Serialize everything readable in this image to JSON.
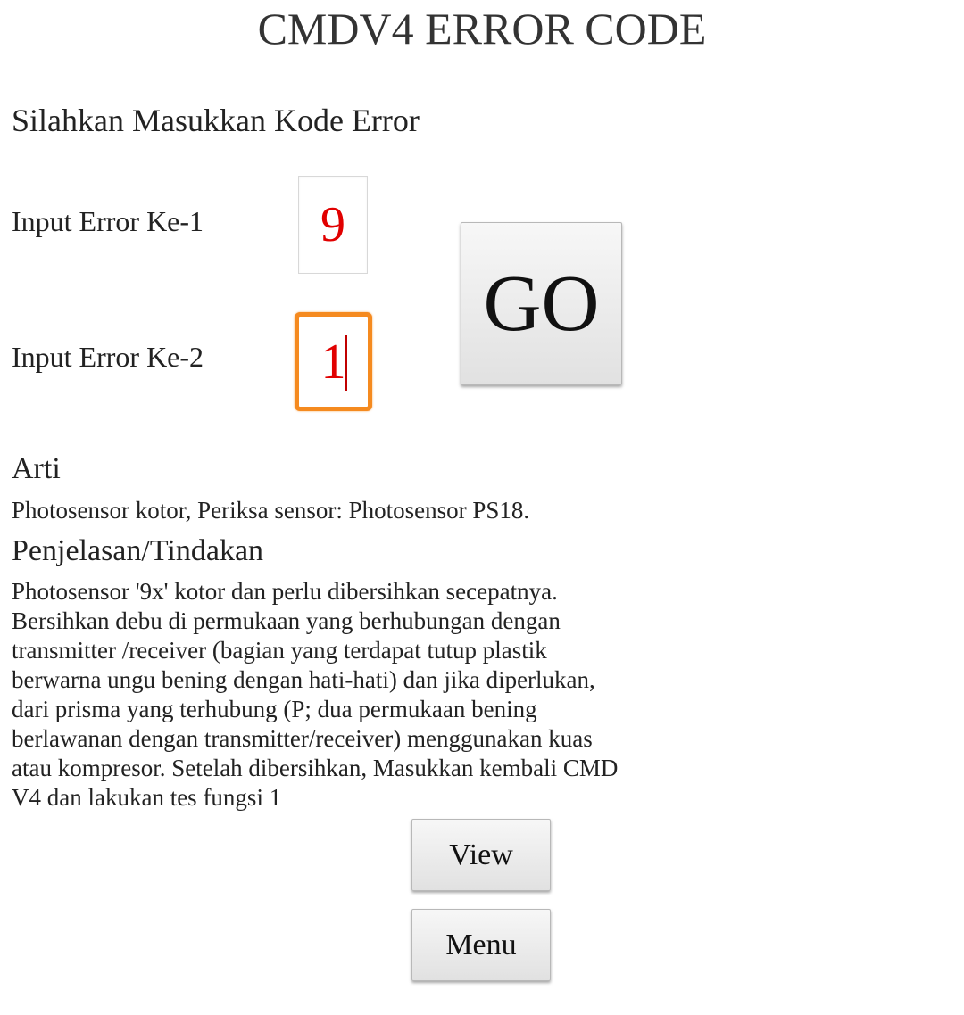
{
  "header": {
    "title": "CMDV4 ERROR CODE"
  },
  "form": {
    "prompt": "Silahkan Masukkan Kode Error",
    "input1": {
      "label": "Input Error Ke-1",
      "value": "9"
    },
    "input2": {
      "label": "Input Error Ke-2",
      "value": "1"
    },
    "go_label": "GO"
  },
  "result": {
    "meaning_heading": "Arti",
    "meaning_text": "Photosensor kotor, Periksa sensor: Photosensor PS18.",
    "action_heading": "Penjelasan/Tindakan",
    "action_lines": [
      "Photosensor '9x' kotor dan perlu dibersihkan secepatnya.",
      "Bersihkan debu di permukaan yang berhubungan dengan",
      "transmitter /receiver (bagian yang terdapat tutup plastik",
      "berwarna ungu bening dengan hati-hati) dan jika diperlukan,",
      "dari prisma yang terhubung (P; dua  permukaan bening",
      "berlawanan dengan transmitter/receiver) menggunakan kuas",
      "atau kompresor. Setelah dibersihkan, Masukkan kembali CMD",
      "V4 dan lakukan tes fungsi 1"
    ]
  },
  "actions": {
    "view_label": "View",
    "menu_label": "Menu"
  },
  "colors": {
    "input_text": "#e10000",
    "focus_border": "#f58a1f"
  }
}
